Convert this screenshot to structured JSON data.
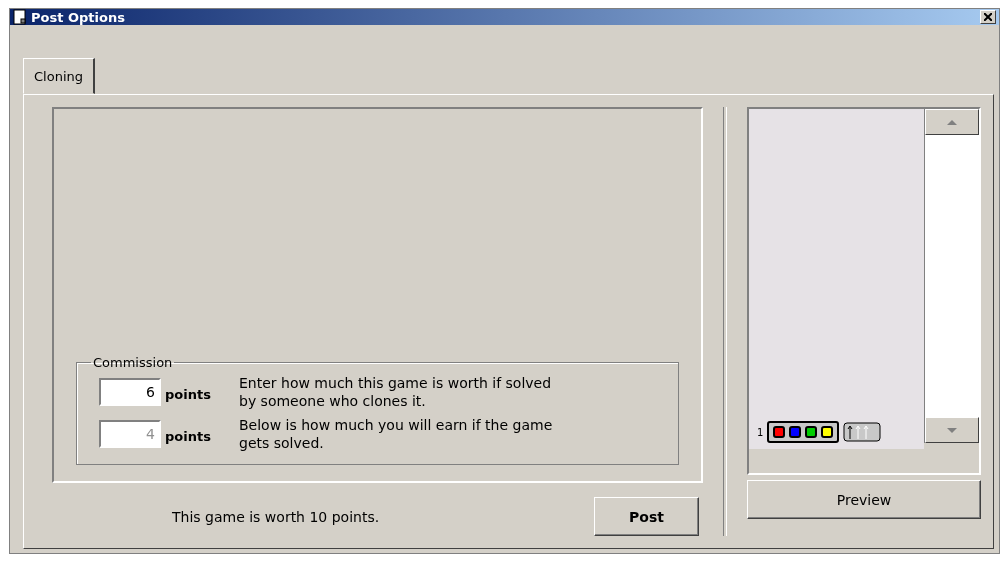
{
  "window": {
    "title": "Post Options"
  },
  "tabs": [
    {
      "label": "Cloning",
      "selected": true
    }
  ],
  "commission": {
    "legend": "Commission",
    "rows": [
      {
        "value": "6",
        "unit": "points",
        "disabled": false,
        "text": "Enter how much this game is worth if solved by someone who clones it."
      },
      {
        "value": "4",
        "unit": "points",
        "disabled": true,
        "text": "Below is how much you will earn if the game gets solved."
      }
    ]
  },
  "worth_text": "This game is worth 10 points.",
  "post_button": "Post",
  "preview": {
    "rows": [
      {
        "number": "1",
        "pegs": [
          {
            "color": "#ff0000"
          },
          {
            "color": "#0000ff"
          },
          {
            "color": "#00cc00"
          },
          {
            "color": "#ffff00"
          }
        ]
      }
    ]
  },
  "preview_button": "Preview"
}
